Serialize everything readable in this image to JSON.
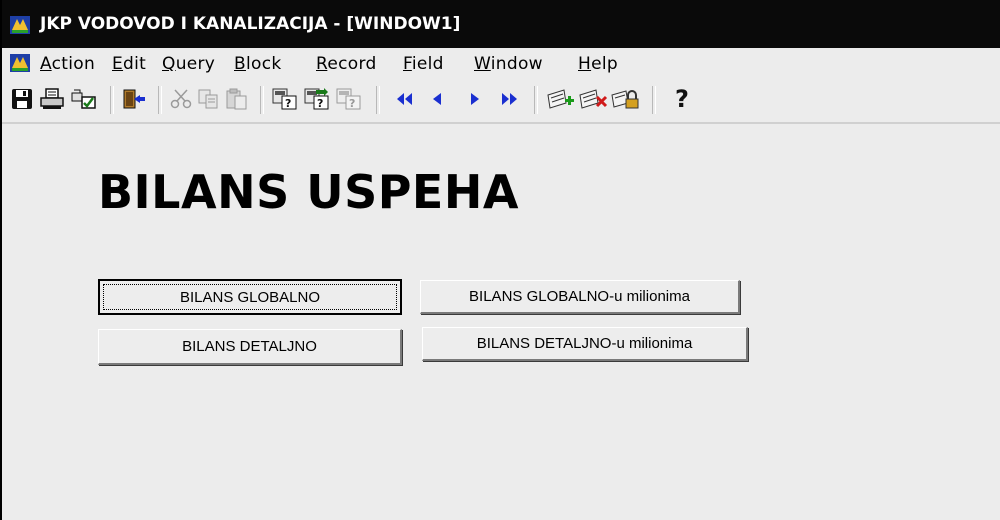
{
  "window": {
    "title": "JKP VODOVOD I KANALIZACIJA - [WINDOW1]"
  },
  "menu": {
    "items": [
      {
        "accel": "A",
        "rest": "ction"
      },
      {
        "accel": "E",
        "rest": "dit"
      },
      {
        "accel": "Q",
        "rest": "uery"
      },
      {
        "accel": "B",
        "rest": "lock"
      },
      {
        "accel": "R",
        "rest": "ecord"
      },
      {
        "accel": "F",
        "rest": "ield"
      },
      {
        "accel": "W",
        "rest": "indow"
      },
      {
        "accel": "H",
        "rest": "elp"
      }
    ]
  },
  "toolbar": {
    "icons": [
      "save-icon",
      "print-icon",
      "print-setup-icon",
      "exit-icon",
      "cut-icon",
      "copy-icon",
      "paste-icon",
      "enter-query-icon",
      "execute-query-icon",
      "cancel-query-icon",
      "first-record-icon",
      "previous-record-icon",
      "next-record-icon",
      "last-record-icon",
      "insert-record-icon",
      "delete-record-icon",
      "lock-record-icon",
      "help-icon"
    ],
    "help_label": "?"
  },
  "main": {
    "heading": "BILANS USPEHA",
    "buttons": {
      "global": "BILANS GLOBALNO",
      "global_millions": "BILANS GLOBALNO-u milionima",
      "detail": "BILANS DETALJNO",
      "detail_millions": "BILANS DETALJNO-u milionima"
    }
  },
  "colors": {
    "titlebar": "#0a0a0a",
    "background": "#ececec",
    "nav_arrows": "#1a2fd0"
  }
}
